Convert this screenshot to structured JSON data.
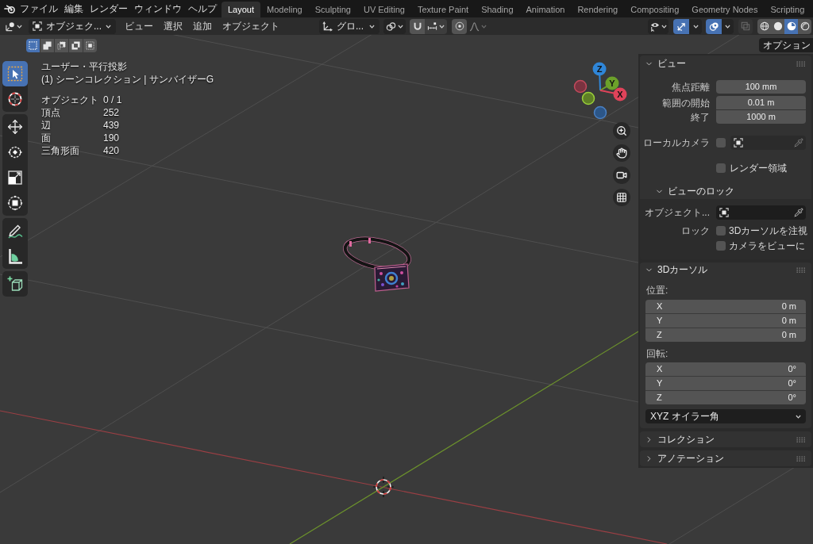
{
  "topbar": {
    "menus": [
      "ファイル",
      "編集",
      "レンダー",
      "ウィンドウ",
      "ヘルプ"
    ],
    "workspaces": [
      {
        "label": "Layout",
        "selected": true
      },
      {
        "label": "Modeling",
        "selected": false
      },
      {
        "label": "Sculpting",
        "selected": false
      },
      {
        "label": "UV Editing",
        "selected": false
      },
      {
        "label": "Texture Paint",
        "selected": false
      },
      {
        "label": "Shading",
        "selected": false
      },
      {
        "label": "Animation",
        "selected": false
      },
      {
        "label": "Rendering",
        "selected": false
      },
      {
        "label": "Compositing",
        "selected": false
      },
      {
        "label": "Geometry Nodes",
        "selected": false
      },
      {
        "label": "Scripting",
        "selected": false
      }
    ]
  },
  "header": {
    "mode": "オブジェク...",
    "menus": [
      "ビュー",
      "選択",
      "追加",
      "オブジェクト"
    ],
    "orientation": "グロ...",
    "snap": {
      "on": false
    },
    "proportional": {
      "on": false
    },
    "gizmos": {
      "on": true
    },
    "overlays": {
      "on": true
    },
    "xray": {
      "on": false
    },
    "shading": [
      {
        "kind": "wireframe",
        "selected": false
      },
      {
        "kind": "solid",
        "selected": false
      },
      {
        "kind": "material",
        "selected": true
      },
      {
        "kind": "rendered",
        "selected": false
      }
    ],
    "select_modes": [
      {
        "kind": "new",
        "selected": true
      },
      {
        "kind": "extend",
        "selected": false
      },
      {
        "kind": "subtract",
        "selected": false
      },
      {
        "kind": "difference",
        "selected": false
      },
      {
        "kind": "intersect",
        "selected": false
      }
    ],
    "options": "オプション"
  },
  "toolbar": {
    "groups": [
      {
        "tools": [
          {
            "kind": "select",
            "selected": true
          },
          {
            "kind": "cursor",
            "selected": false
          }
        ]
      },
      {
        "tools": [
          {
            "kind": "move",
            "selected": false
          },
          {
            "kind": "rotate",
            "selected": false
          },
          {
            "kind": "scale",
            "selected": false
          },
          {
            "kind": "transform",
            "selected": false
          }
        ]
      },
      {
        "tools": [
          {
            "kind": "annotate",
            "selected": false
          },
          {
            "kind": "measure",
            "selected": false
          }
        ]
      },
      {
        "tools": [
          {
            "kind": "add_cube",
            "selected": false
          }
        ]
      }
    ]
  },
  "stats": {
    "view": "ユーザー・平行投影",
    "collection": "(1) シーンコレクション | サンバイザーG",
    "rows": [
      {
        "label": "オブジェクト",
        "value": "0 / 1"
      },
      {
        "label": "頂点",
        "value": "252"
      },
      {
        "label": "辺",
        "value": "439"
      },
      {
        "label": "面",
        "value": "190"
      },
      {
        "label": "三角形面",
        "value": "420"
      }
    ]
  },
  "gizmo": {
    "axes": [
      {
        "kind": "z",
        "label": "Z"
      },
      {
        "kind": "y",
        "label": "Y"
      },
      {
        "kind": "x",
        "label": "X"
      }
    ]
  },
  "navigation": [
    {
      "kind": "zoom"
    },
    {
      "kind": "pan"
    },
    {
      "kind": "camera"
    },
    {
      "kind": "ortho"
    }
  ],
  "sidebar": {
    "view_panel": {
      "title": "ビュー",
      "expanded": true,
      "lens": {
        "label": "焦点距離",
        "value": "100 mm"
      },
      "clip": [
        {
          "label": "範囲の開始",
          "value": "0.01 m"
        },
        {
          "label": "終了",
          "value": "1000 m"
        }
      ],
      "local_camera": {
        "label": "ローカルカメラ",
        "checked": false
      },
      "render_region": {
        "label": "レンダー領域",
        "checked": false
      }
    },
    "view_lock_panel": {
      "title": "ビューのロック",
      "expanded": true,
      "object_label": "オブジェクト...",
      "lock_label": "ロック",
      "options": [
        {
          "label": "3Dカーソルを注視",
          "checked": false
        },
        {
          "label": "カメラをビューに",
          "checked": false
        }
      ]
    },
    "cursor_panel": {
      "title": "3Dカーソル",
      "expanded": true,
      "location_label": "位置:",
      "location": [
        {
          "axis": "X",
          "value": "0 m"
        },
        {
          "axis": "Y",
          "value": "0 m"
        },
        {
          "axis": "Z",
          "value": "0 m"
        }
      ],
      "rotation_label": "回転:",
      "rotation": [
        {
          "axis": "X",
          "value": "0°"
        },
        {
          "axis": "Y",
          "value": "0°"
        },
        {
          "axis": "Z",
          "value": "0°"
        }
      ],
      "rotation_mode": "XYZ オイラー角"
    },
    "collapsed_panels": [
      {
        "title": "コレクション",
        "expanded": false
      },
      {
        "title": "アノテーション",
        "expanded": false
      }
    ]
  }
}
